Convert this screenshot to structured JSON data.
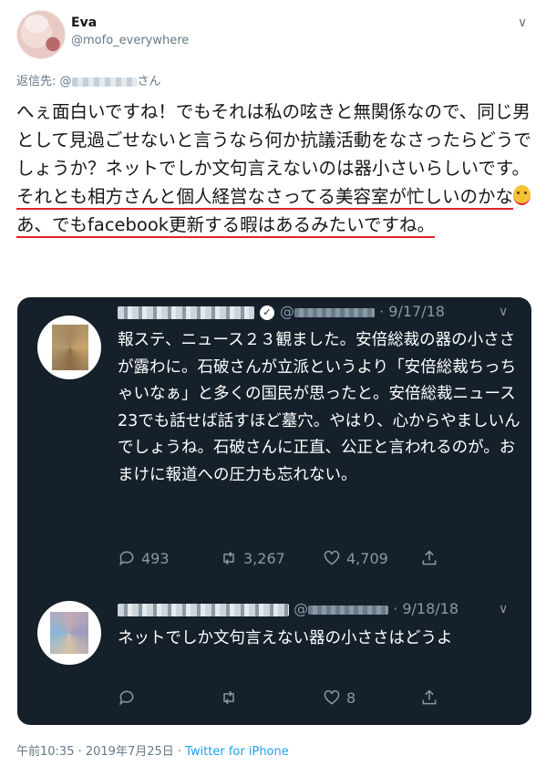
{
  "author": {
    "name": "Eva",
    "handle": "@mofo_everywhere"
  },
  "reply_to": {
    "prefix": "返信先: @",
    "suffix": "さん"
  },
  "body": {
    "line_plain": "へぇ面白いですね！でもそれは私の呟きと無関係なので、同じ男として見過ごせないと言うなら何か抗議活動をなさったらどうでしょうか？ネットでしか文句言えないのは器小さいらしいです。",
    "line_underlined_1": "それとも相方さんと個人経営なさってる美容室が忙しいのかな",
    "line_underlined_2": "あ、でもfacebook更新する暇はあるみたいですね。"
  },
  "quoted_thread": {
    "tweet1": {
      "handle_prefix": "@",
      "date": "· 9/17/18",
      "text": "報ステ、ニュース２３観ました。安倍総裁の器の小ささが露わに。石破さんが立派というより「安倍総裁ちっちゃいなぁ」と多くの国民が思ったと。安倍総裁ニュース23でも話せば話すほど墓穴。やはり、心からやましいんでしょうね。石破さんに正直、公正と言われるのが。おまけに報道への圧力も忘れない。",
      "replies": "493",
      "retweets": "3,267",
      "likes": "4,709"
    },
    "tweet2": {
      "handle_prefix": "@",
      "date": "· 9/18/18",
      "text": "ネットでしか文句言えない器の小ささはどうよ",
      "replies": "",
      "retweets": "",
      "likes": "8"
    }
  },
  "footer": {
    "timestamp": "午前10:35 · 2019年7月25日 · ",
    "source": "Twitter for iPhone"
  },
  "colors": {
    "link": "#1da1f2",
    "underline": "#e0242a",
    "dark_bg": "#15202b",
    "muted": "#8899a6"
  }
}
